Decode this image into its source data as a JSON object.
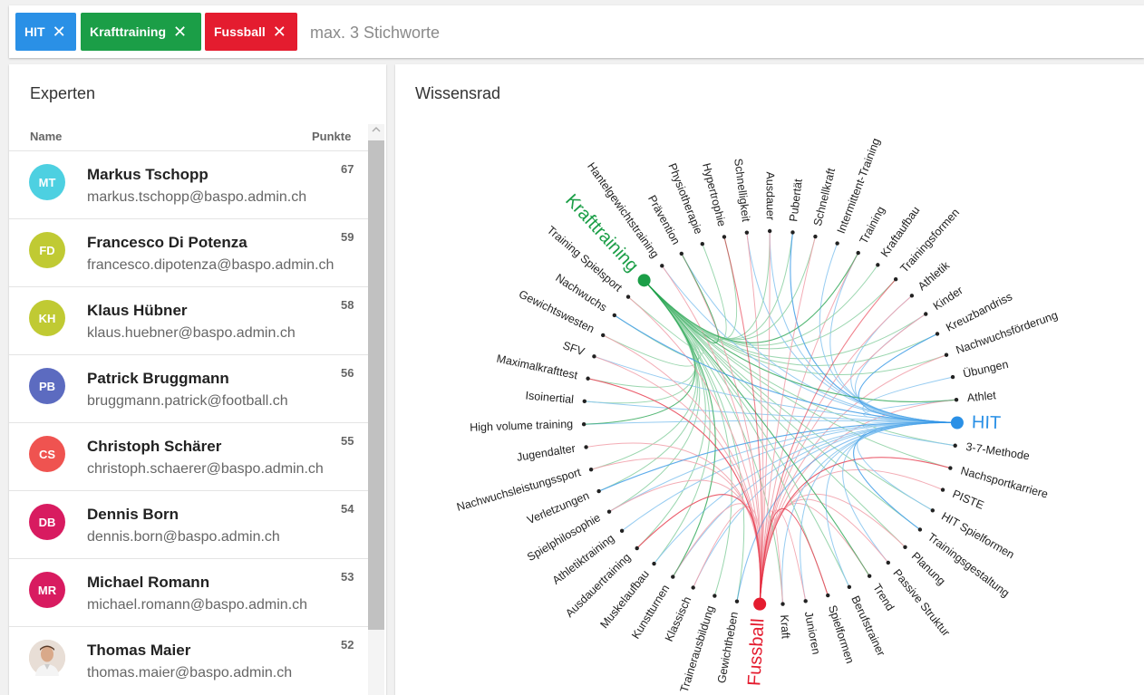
{
  "search": {
    "chips": [
      {
        "label": "HIT",
        "color": "#2a90e6"
      },
      {
        "label": "Krafttraining",
        "color": "#1b9e47"
      },
      {
        "label": "Fussball",
        "color": "#e41c2f"
      }
    ],
    "remove_symbol": "✕",
    "placeholder": "max. 3 Stichworte"
  },
  "experts": {
    "title": "Experten",
    "col_name": "Name",
    "col_points": "Punkte",
    "rows": [
      {
        "initials": "MT",
        "color": "#4dd0e1",
        "name": "Markus Tschopp",
        "email": "markus.tschopp@baspo.admin.ch",
        "points": "67"
      },
      {
        "initials": "FD",
        "color": "#c0ca33",
        "name": "Francesco Di Potenza",
        "email": "francesco.dipotenza@baspo.admin.ch",
        "points": "59"
      },
      {
        "initials": "KH",
        "color": "#c0ca33",
        "name": "Klaus Hübner",
        "email": "klaus.huebner@baspo.admin.ch",
        "points": "58"
      },
      {
        "initials": "PB",
        "color": "#5c6bc0",
        "name": "Patrick Bruggmann",
        "email": "bruggmann.patrick@football.ch",
        "points": "56"
      },
      {
        "initials": "CS",
        "color": "#ef5350",
        "name": "Christoph Schärer",
        "email": "christoph.schaerer@baspo.admin.ch",
        "points": "55"
      },
      {
        "initials": "DB",
        "color": "#d81b60",
        "name": "Dennis Born",
        "email": "dennis.born@baspo.admin.ch",
        "points": "54"
      },
      {
        "initials": "MR",
        "color": "#d81b60",
        "name": "Michael Romann",
        "email": "michael.romann@baspo.admin.ch",
        "points": "53"
      },
      {
        "initials": "",
        "color": "#dcc3b0",
        "name": "Thomas Maier",
        "email": "thomas.maier@baspo.admin.ch",
        "points": "52"
      }
    ]
  },
  "wheel": {
    "title": "Wissensrad",
    "hubs": [
      {
        "label": "Krafttraining",
        "color": "#1b9e47"
      },
      {
        "label": "HIT",
        "color": "#2a90e6"
      },
      {
        "label": "Fussball",
        "color": "#e41c2f"
      }
    ],
    "topics": [
      "Training",
      "Kraftaufbau",
      "Trainingsformen",
      "Athletik",
      "Kinder",
      "Kreuzbandriss",
      "Nachwuchsförderung",
      "Übungen",
      "Athlet",
      "3-7-Methode",
      "Nachsportkarriere",
      "PISTE",
      "HIT Spielformen",
      "Trainingsgestaltung",
      "Planung",
      "Passive Struktur",
      "Trend",
      "Berufstrainer",
      "Spielformen",
      "Junioren",
      "Kraft",
      "Gewichtheben",
      "Traineraus­bildung",
      "Klassisch",
      "Kunstturnen",
      "Muskelaufbau",
      "Ausdauertraining",
      "Athletiktraining",
      "Spielphilosophie",
      "Verletzungen",
      "Nachwuchsleistungssport",
      "Jugendalter",
      "High volume training",
      "Isoinertial",
      "Maximalkrafttest",
      "SFV",
      "Gewichtswesten",
      "Nachwuchs",
      "Training Spielsport",
      "Hantelgewichtstraining",
      "Prävention",
      "Physiotherapie",
      "Hypertrophie",
      "Schnelligkeit",
      "Ausdauer",
      "Pubertät",
      "Schnellkraft",
      "Intermittent-Training"
    ]
  }
}
